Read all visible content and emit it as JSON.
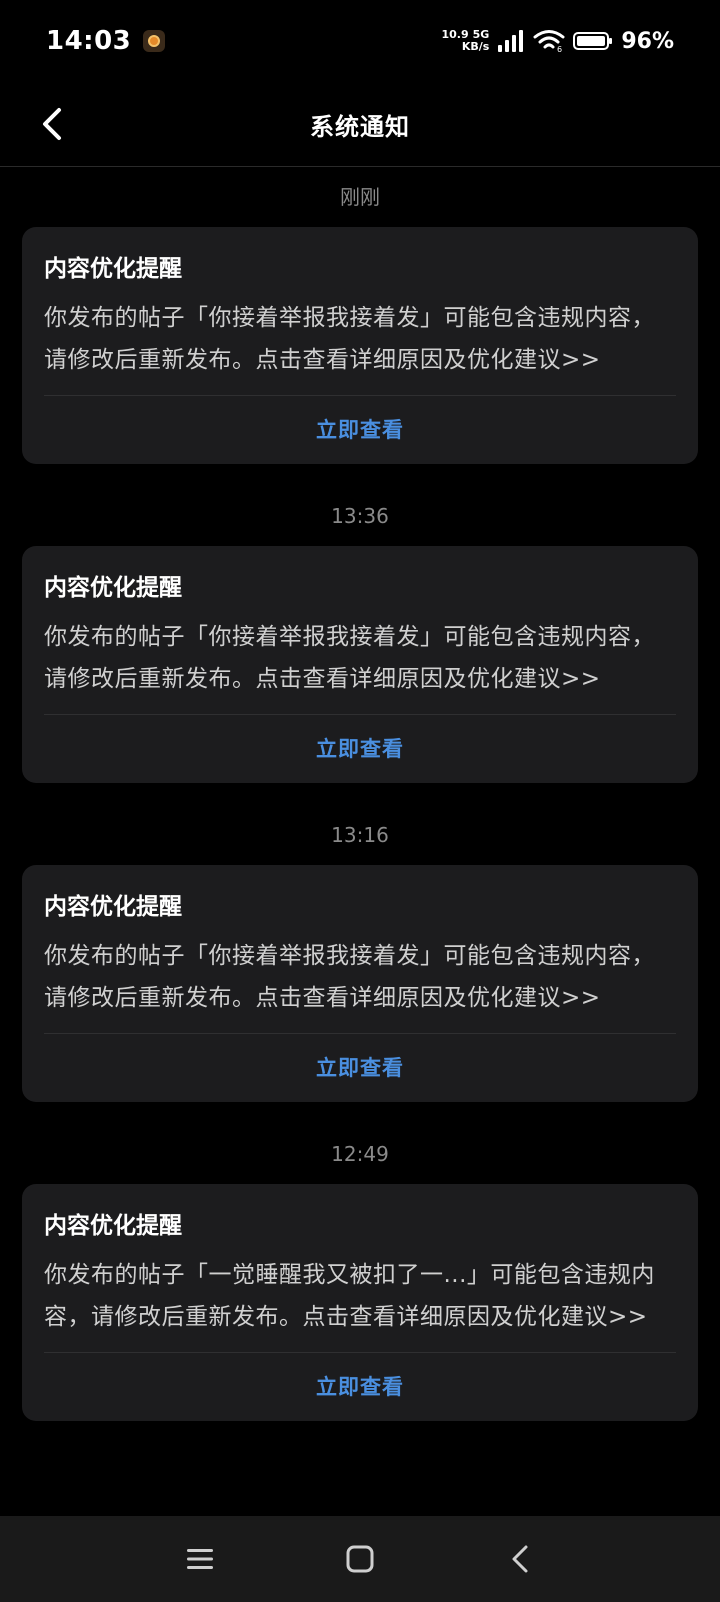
{
  "status_bar": {
    "time": "14:03",
    "net_speed_value": "10.9",
    "net_speed_unit": "KB/s",
    "network_type": "5G",
    "battery_percent": "96%"
  },
  "header": {
    "title": "系统通知"
  },
  "notifications": [
    {
      "time": "刚刚",
      "title": "内容优化提醒",
      "body": "你发布的帖子「你接着举报我接着发」可能包含违规内容，请修改后重新发布。点击查看详细原因及优化建议>>",
      "action_label": "立即查看"
    },
    {
      "time": "13:36",
      "title": "内容优化提醒",
      "body": "你发布的帖子「你接着举报我接着发」可能包含违规内容，请修改后重新发布。点击查看详细原因及优化建议>>",
      "action_label": "立即查看"
    },
    {
      "time": "13:16",
      "title": "内容优化提醒",
      "body": "你发布的帖子「你接着举报我接着发」可能包含违规内容，请修改后重新发布。点击查看详细原因及优化建议>>",
      "action_label": "立即查看"
    },
    {
      "time": "12:49",
      "title": "内容优化提醒",
      "body": "你发布的帖子「一觉睡醒我又被扣了一...」可能包含违规内容，请修改后重新发布。点击查看详细原因及优化建议>>",
      "action_label": "立即查看"
    }
  ],
  "colors": {
    "background": "#000000",
    "card": "#1c1c1e",
    "link": "#4a8fe0",
    "muted": "#8a8a8a"
  }
}
